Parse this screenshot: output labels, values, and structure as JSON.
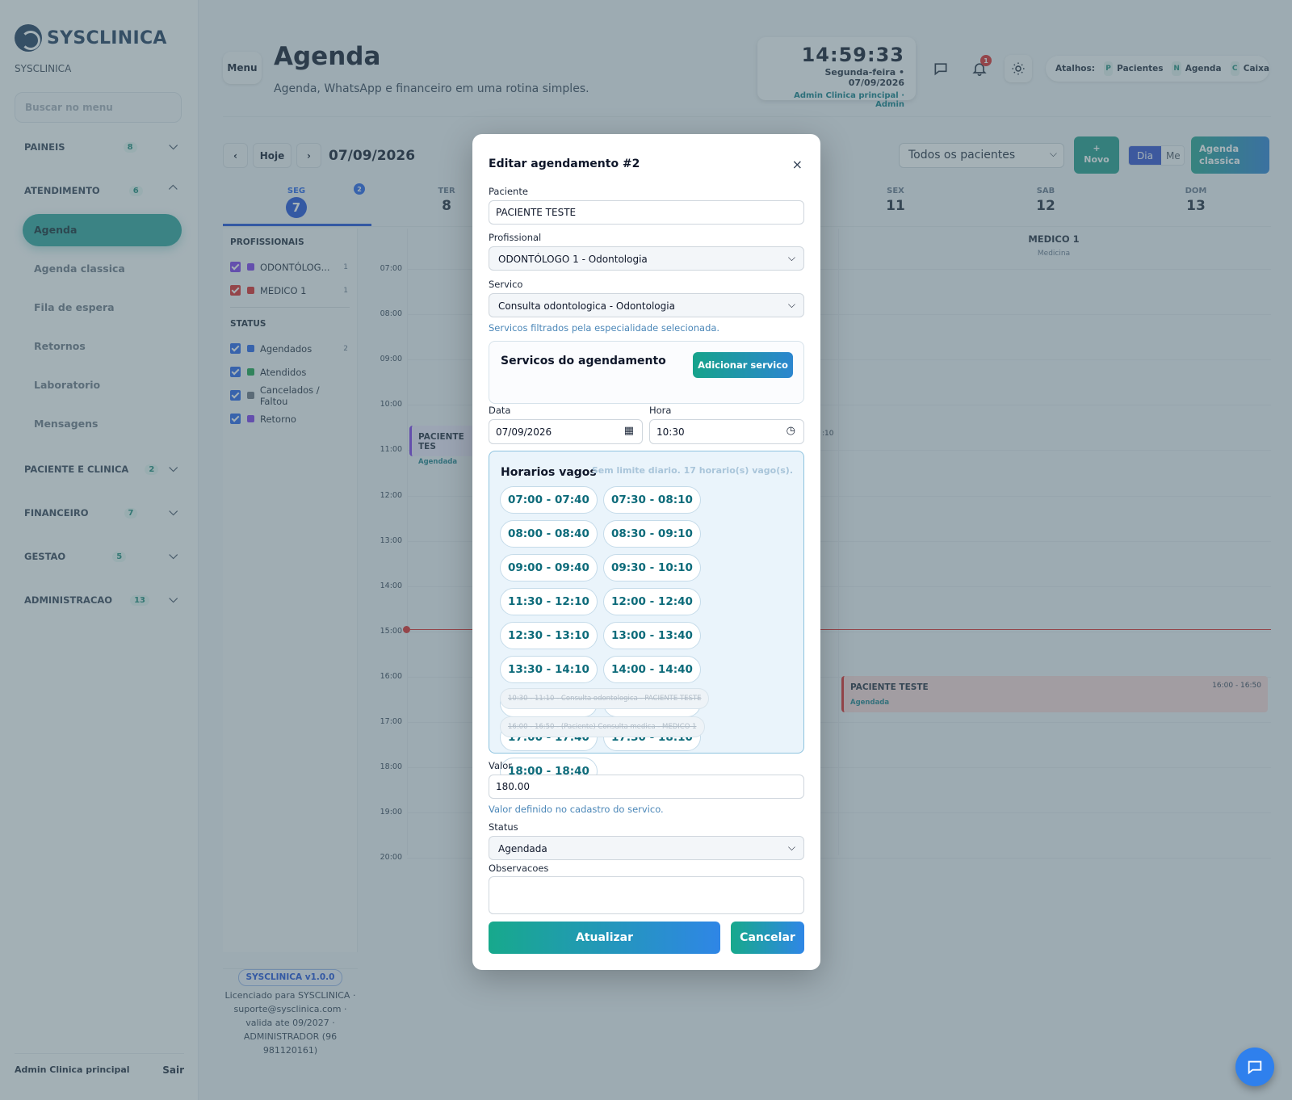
{
  "sidebar": {
    "logo_text": "SYSCLINICA",
    "clinic_name": "SYSCLINICA",
    "search_placeholder": "Buscar no menu",
    "sections": [
      {
        "label": "PAINEIS",
        "count": "8"
      },
      {
        "label": "ATENDIMENTO",
        "count": "6"
      },
      {
        "label": "PACIENTE E CLINICA",
        "count": "2"
      },
      {
        "label": "FINANCEIRO",
        "count": "7"
      },
      {
        "label": "GESTAO",
        "count": "5"
      },
      {
        "label": "ADMINISTRACAO",
        "count": "13"
      }
    ],
    "items": [
      "Agenda",
      "Agenda classica",
      "Fila de espera",
      "Retornos",
      "Laboratorio",
      "Mensagens"
    ],
    "footer_user": "Admin Clinica principal",
    "footer_logout": "Sair"
  },
  "header": {
    "menu_label": "Menu",
    "title": "Agenda",
    "subtitle": "Agenda, WhatsApp e financeiro em uma rotina simples.",
    "clock_time": "14:59:33",
    "clock_date": "Segunda-feira • 07/09/2026",
    "clock_user": "Admin Clinica principal · Admin",
    "notif_count": "1",
    "shortcuts_label": "Atalhos:",
    "shortcuts": [
      {
        "key": "P",
        "label": "Pacientes"
      },
      {
        "key": "N",
        "label": "Agenda"
      },
      {
        "key": "C",
        "label": "Caixa"
      }
    ]
  },
  "calendar": {
    "prev": "‹",
    "today": "Hoje",
    "next": "›",
    "date": "07/09/2026",
    "patient_filter": "Todos os pacientes",
    "new_label_plus": "+",
    "new_label": "Novo",
    "view_day": "Dia",
    "view_month": "Me",
    "classic_label_1": "Agenda",
    "classic_label_2": "classica",
    "days": [
      {
        "name": "SEG",
        "num": "7"
      },
      {
        "name": "TER",
        "num": "8"
      },
      {
        "name": "SEX",
        "num": "11"
      },
      {
        "name": "SAB",
        "num": "12"
      },
      {
        "name": "DOM",
        "num": "13"
      }
    ],
    "day_badge": "2",
    "filters": {
      "prof_title": "PROFISSIONAIS",
      "professionals": [
        {
          "label": "ODONTÓLOG...",
          "count": "1",
          "color": "#7c3aed"
        },
        {
          "label": "MEDICO 1",
          "count": "1",
          "color": "#dc2626"
        }
      ],
      "status_title": "STATUS",
      "statuses": [
        {
          "label": "Agendados",
          "count": "2",
          "color": "#2563eb"
        },
        {
          "label": "Atendidos",
          "count": "",
          "color": "#16a34a"
        },
        {
          "label": "Cancelados / Faltou",
          "count": "",
          "color": "#6b7280"
        },
        {
          "label": "Retorno",
          "count": "",
          "color": "#7c3aed"
        }
      ]
    },
    "hours": [
      "07:00",
      "08:00",
      "09:00",
      "10:00",
      "11:00",
      "12:00",
      "13:00",
      "14:00",
      "15:00",
      "16:00",
      "17:00",
      "18:00",
      "19:00",
      "20:00"
    ],
    "column_header": {
      "title": "MEDICO 1",
      "subtitle": "Medicina"
    },
    "appointments": [
      {
        "name": "PACIENTE TES",
        "status": "Agendada",
        "time": ""
      },
      {
        "name": "PACIENTE TESTE",
        "status": "Agendada",
        "time": "16:00 - 16:50"
      }
    ],
    "partial_time": ":10"
  },
  "version": {
    "badge": "SYSCLINICA v1.0.0",
    "license": "Licenciado para SYSCLINICA · suporte@sysclinica.com · valida ate 09/2027 · ADMINISTRADOR (96 981120161)"
  },
  "modal": {
    "title": "Editar agendamento #2",
    "close": "×",
    "patient_label": "Paciente",
    "patient_value": "PACIENTE TESTE",
    "professional_label": "Profissional",
    "professional_value": "ODONTÓLOGO 1 - Odontologia",
    "service_label": "Servico",
    "service_value": "Consulta odontologica - Odontologia",
    "service_hint": "Servicos filtrados pela especialidade selecionada.",
    "services_title": "Servicos do agendamento",
    "add_service": "Adicionar servico",
    "date_label": "Data",
    "date_value": "07/09/2026",
    "time_label": "Hora",
    "time_value": "10:30",
    "slots_title": "Horarios vagos",
    "slots_limit": "Sem limite diario. 17 horario(s) vago(s).",
    "slots": [
      "07:00 - 07:40",
      "07:30 - 08:10",
      "08:00 - 08:40",
      "08:30 - 09:10",
      "09:00 - 09:40",
      "09:30 - 10:10",
      "11:30 - 12:10",
      "12:00 - 12:40",
      "12:30 - 13:10",
      "13:00 - 13:40",
      "13:30 - 14:10",
      "14:00 - 14:40",
      "14:30 - 15:10",
      "15:00 - 15:40",
      "17:00 - 17:40",
      "17:30 - 18:10",
      "18:00 - 18:40"
    ],
    "busy": [
      "10:30 - 11:10 - Consulta odontologica - PACIENTE TESTE",
      "16:00 - 16:50 - (Paciente) Consulta medica - MEDICO 1"
    ],
    "value_label": "Valor",
    "value": "180.00",
    "value_hint": "Valor definido no cadastro do servico.",
    "status_label": "Status",
    "status_value": "Agendada",
    "notes_label": "Observacoes",
    "update": "Atualizar",
    "cancel": "Cancelar"
  }
}
